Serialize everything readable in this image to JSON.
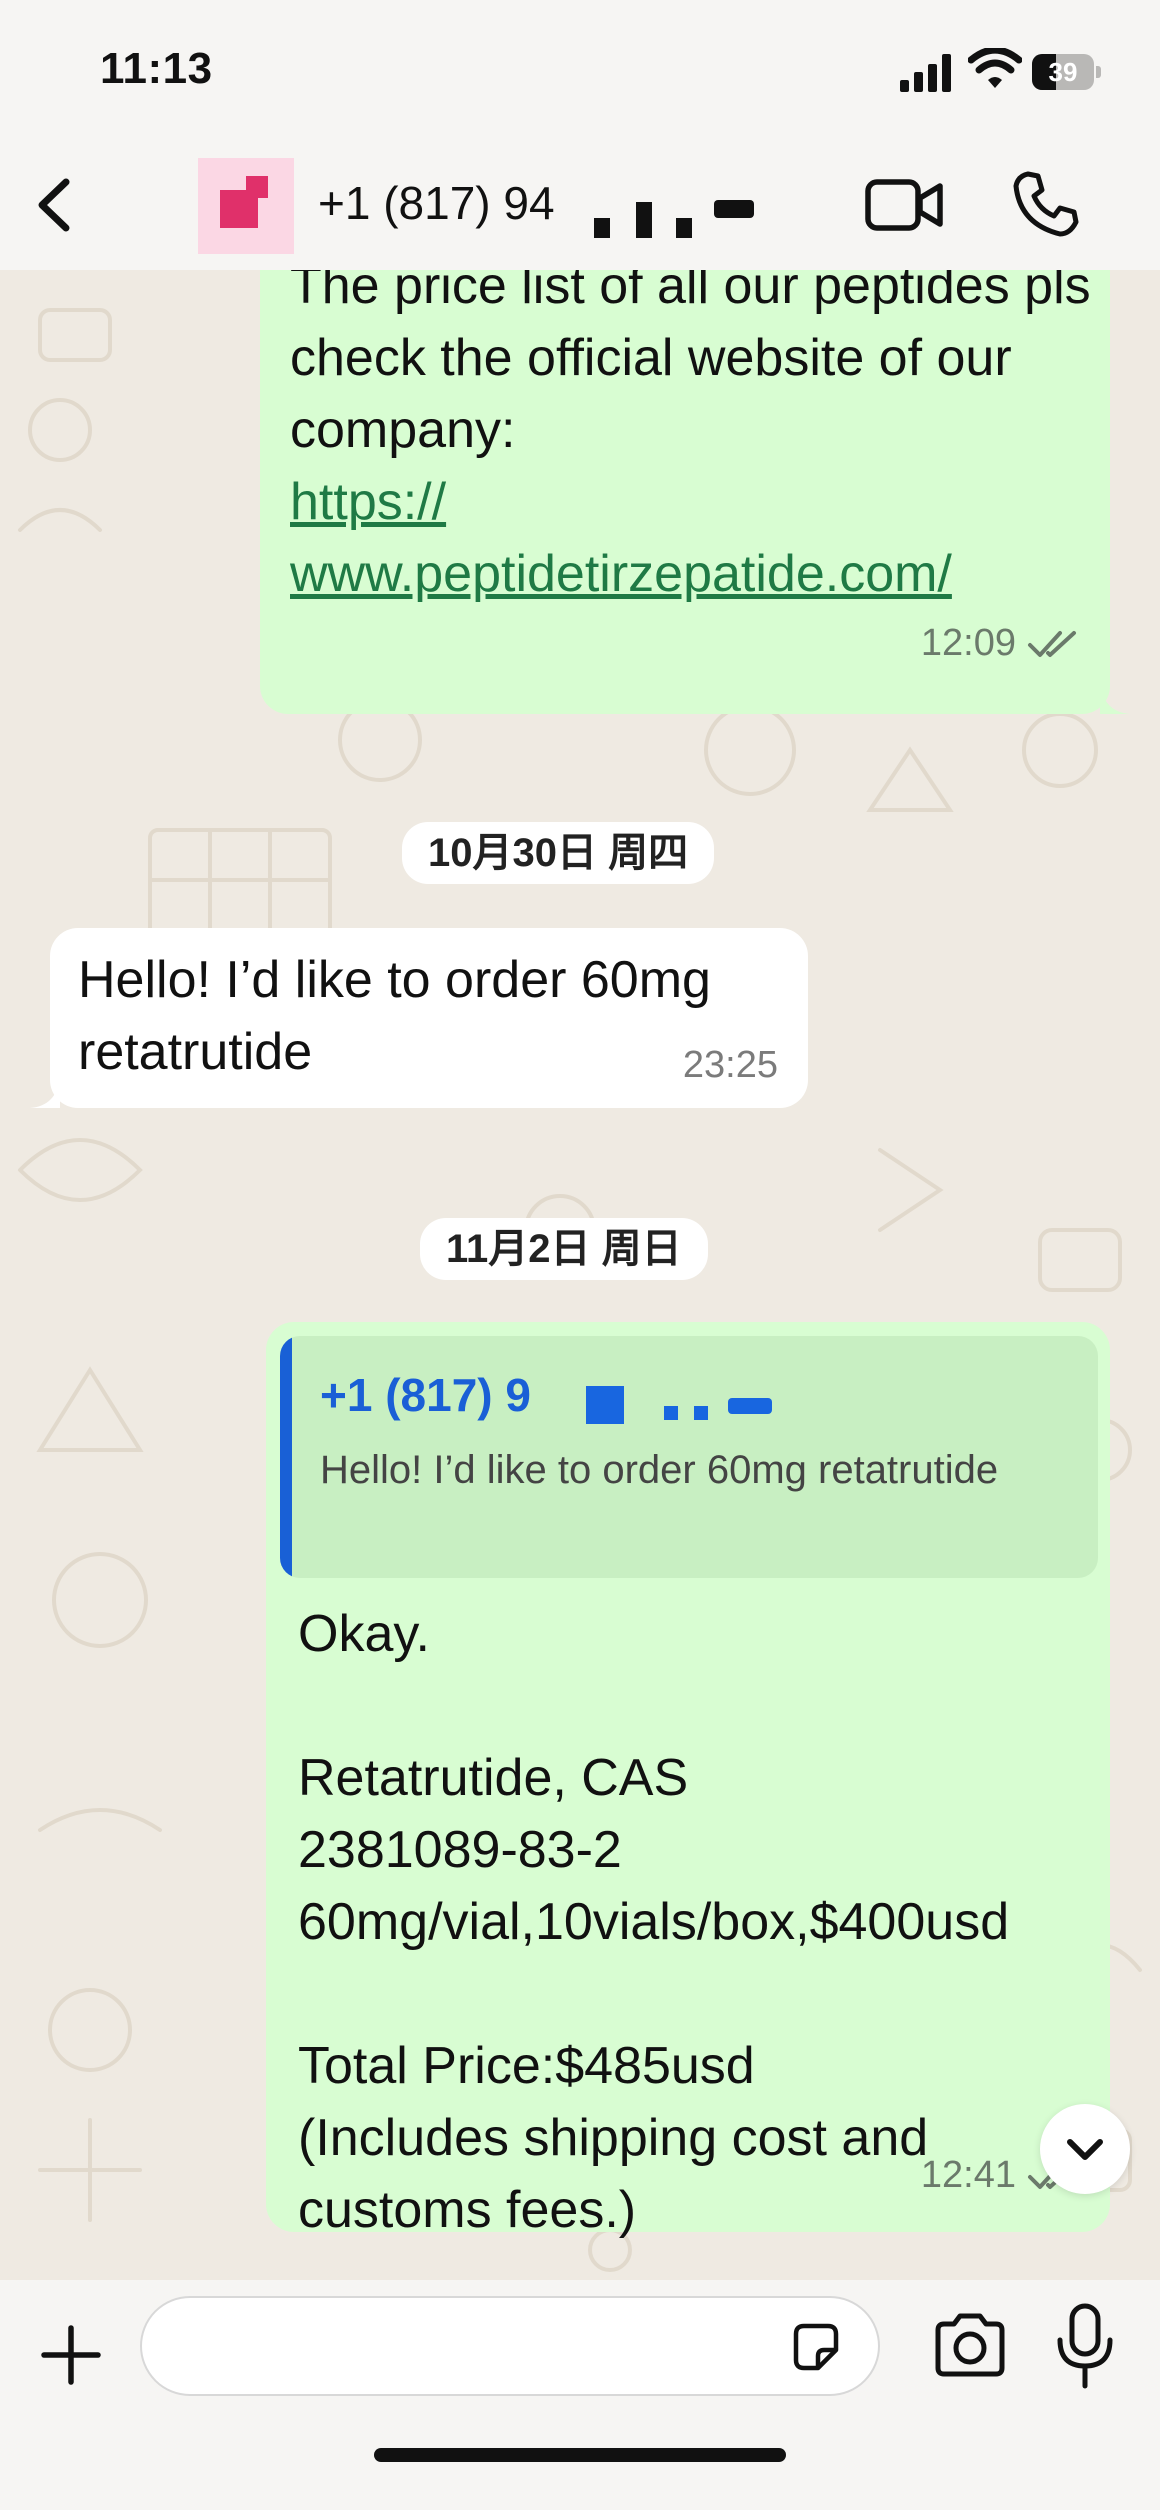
{
  "status_bar": {
    "time": "11:13",
    "battery": "39",
    "battery_level": 0.39
  },
  "header": {
    "contact_name": "+1 (817) 94"
  },
  "messages": [
    {
      "id": "m1",
      "type": "outgoing",
      "text": "The price list of all our peptides pls check the official website of our company:",
      "link": "https://\nwww.peptidetirzepatide.com/",
      "time": "12:09"
    },
    {
      "id": "d1",
      "type": "date",
      "text": "10月30日 周四"
    },
    {
      "id": "m2",
      "type": "incoming",
      "text": "Hello! I’d like to order 60mg\nretatrutide",
      "time": "23:25"
    },
    {
      "id": "d2",
      "type": "date",
      "text": "11月2日 周日"
    },
    {
      "id": "m3",
      "type": "outgoing",
      "quote": {
        "name": "+1 (817) 9",
        "text": "Hello! I’d like to order 60mg retatrutide"
      },
      "text": "Okay.\n\nRetatrutide, CAS\n2381089-83-2\n60mg/vial,10vials/box,$400usd\n\nTotal Price:$485usd\n(Includes shipping cost and\ncustoms fees.)",
      "time": "12:41"
    }
  ],
  "icons": {
    "back": "chevron-left-icon",
    "video": "video-camera-icon",
    "phone": "phone-icon",
    "read": "double-check-icon",
    "scroll": "chevron-down-icon",
    "plus": "plus-icon",
    "sticker": "sticker-icon",
    "camera": "camera-icon",
    "mic": "microphone-icon"
  },
  "colors": {
    "outgoing_bubble": "#d8fdd2",
    "incoming_bubble": "#ffffff",
    "link": "#1f7a45",
    "quote_accent": "#1960d6",
    "chat_bg": "#efeae2"
  },
  "composer": {
    "placeholder": ""
  }
}
